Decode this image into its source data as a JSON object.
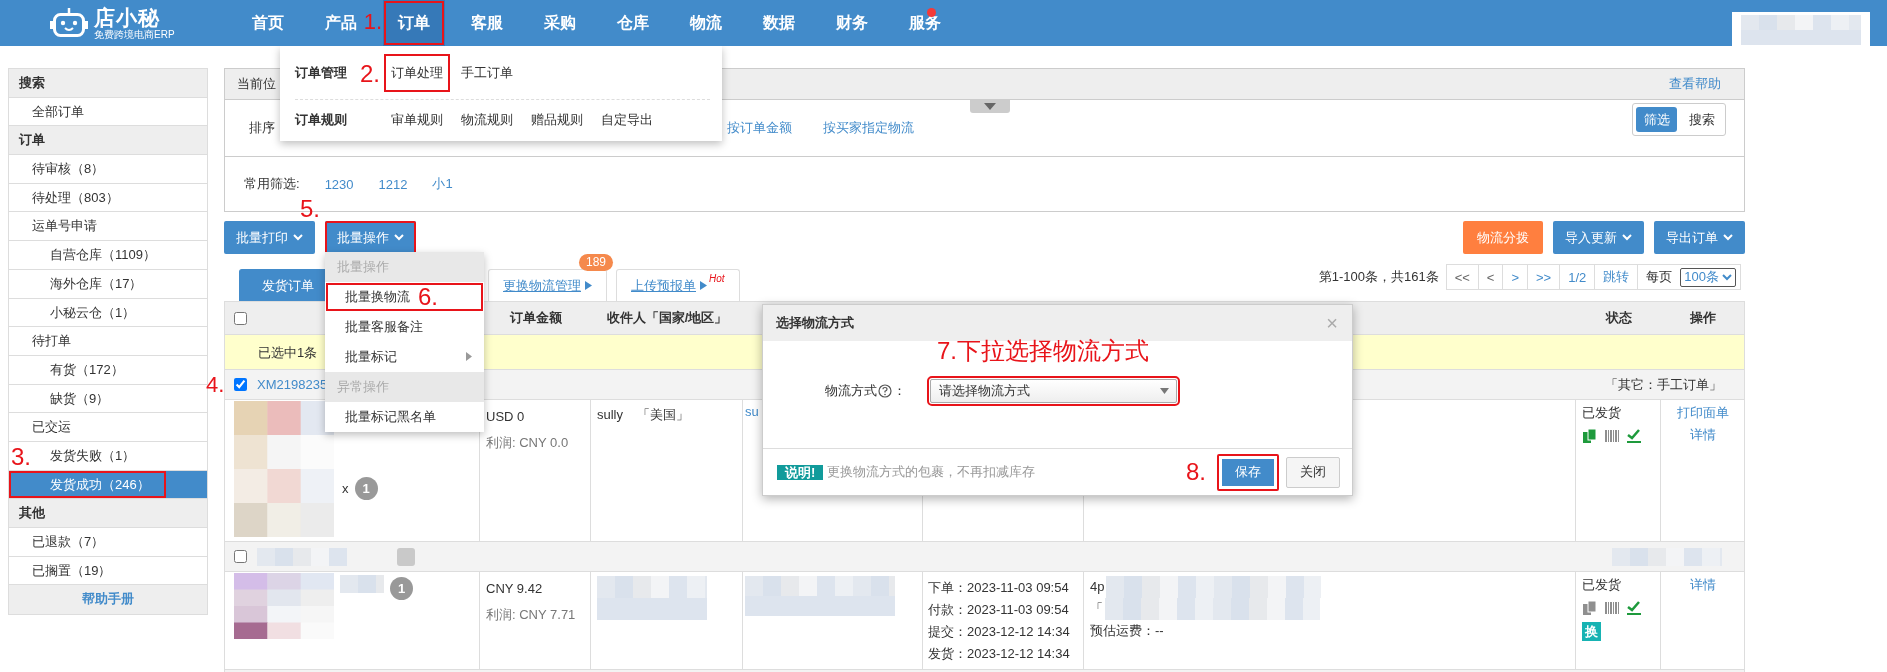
{
  "nav": {
    "logo": {
      "title": "店小秘",
      "subtitle": "免费跨境电商ERP"
    },
    "items": [
      {
        "label": "首页",
        "selected": false,
        "outlined": false,
        "dot": false
      },
      {
        "label": "产品",
        "selected": false,
        "outlined": false,
        "dot": false
      },
      {
        "label": "订单",
        "selected": true,
        "outlined": true,
        "dot": false,
        "annotation": "1."
      },
      {
        "label": "客服",
        "selected": false,
        "outlined": false,
        "dot": false
      },
      {
        "label": "采购",
        "selected": false,
        "outlined": false,
        "dot": false
      },
      {
        "label": "仓库",
        "selected": false,
        "outlined": false,
        "dot": false
      },
      {
        "label": "物流",
        "selected": false,
        "outlined": false,
        "dot": false
      },
      {
        "label": "数据",
        "selected": false,
        "outlined": false,
        "dot": false
      },
      {
        "label": "财务",
        "selected": false,
        "outlined": false,
        "dot": false
      },
      {
        "label": "服务",
        "selected": false,
        "outlined": false,
        "dot": true
      }
    ],
    "user_box": {
      "kind": "redacted"
    }
  },
  "nav_menu": {
    "groups": [
      {
        "title": "订单管理",
        "links": [
          {
            "label": "订单处理",
            "outlined": true,
            "annotation": "2."
          },
          {
            "label": "手工订单",
            "outlined": false
          }
        ]
      },
      {
        "title": "订单规则",
        "links": [
          {
            "label": "审单规则",
            "outlined": false
          },
          {
            "label": "物流规则",
            "outlined": false
          },
          {
            "label": "赠品规则",
            "outlined": false
          },
          {
            "label": "自定导出",
            "outlined": false
          }
        ]
      }
    ]
  },
  "sidebar": {
    "sections": [
      {
        "title": "搜索",
        "items": [
          {
            "label": "全部订单",
            "selected": false
          }
        ]
      },
      {
        "title": "订单",
        "items": [
          {
            "label": "待审核（8）",
            "selected": false
          },
          {
            "label": "待处理（803）",
            "selected": false
          },
          {
            "label": "运单号申请",
            "selected": false,
            "children": [
              {
                "label": "自营仓库（1109）",
                "selected": false
              },
              {
                "label": "海外仓库（17）",
                "selected": false
              },
              {
                "label": "小秘云仓（1）",
                "selected": false
              }
            ]
          },
          {
            "label": "待打单",
            "selected": false,
            "children": [
              {
                "label": "有货（172）",
                "selected": false
              },
              {
                "label": "缺货（9）",
                "selected": false
              }
            ]
          },
          {
            "label": "已交运",
            "selected": false,
            "children": [
              {
                "label": "发货失败（1）",
                "selected": false
              },
              {
                "label": "发货成功（246）",
                "selected": true,
                "outlined": true,
                "annotation": "3."
              }
            ]
          }
        ]
      },
      {
        "title": "其他",
        "items": [
          {
            "label": "已退款（7）",
            "selected": false
          },
          {
            "label": "已搁置（19）",
            "selected": false
          }
        ]
      }
    ],
    "footer": "帮助手册"
  },
  "breadcrumb": {
    "label": "当前位",
    "help": "查看帮助"
  },
  "sort": {
    "label": "排序",
    "options": [
      "按订单金额",
      "按买家指定物流"
    ]
  },
  "view_toggle": [
    {
      "label": "筛选",
      "selected": true
    },
    {
      "label": "搜索",
      "selected": false
    }
  ],
  "common_filters": {
    "label": "常用筛选:",
    "items": [
      "1230",
      "1212",
      "小1"
    ]
  },
  "toolbar": {
    "left": [
      {
        "label": "批量打印",
        "kind": "primary",
        "dropdown": true,
        "outlined": false
      },
      {
        "label": "批量操作",
        "kind": "primary",
        "dropdown": true,
        "outlined": true,
        "annotation": "5."
      }
    ],
    "right": [
      {
        "label": "物流分拨",
        "kind": "warning",
        "dropdown": false,
        "outlined": false
      },
      {
        "label": "导入更新",
        "kind": "primary",
        "dropdown": true,
        "outlined": false
      },
      {
        "label": "导出订单",
        "kind": "primary",
        "dropdown": true,
        "outlined": false
      }
    ]
  },
  "bulk_menu": {
    "items": [
      {
        "kind": "header",
        "label": "批量操作"
      },
      {
        "kind": "item",
        "label": "批量换物流",
        "outlined": true,
        "submenu": false,
        "annotation": "6."
      },
      {
        "kind": "item",
        "label": "批量客服备注",
        "outlined": false,
        "submenu": false
      },
      {
        "kind": "item",
        "label": "批量标记",
        "outlined": false,
        "submenu": true
      },
      {
        "kind": "header",
        "label": "异常操作"
      },
      {
        "kind": "item",
        "label": "批量标记黑名单",
        "outlined": false,
        "submenu": false
      }
    ]
  },
  "tabs": [
    {
      "label": "发货订单",
      "selected": true,
      "arrow": false
    },
    {
      "label": "更换物流管理",
      "selected": false,
      "arrow": true,
      "badge": "189"
    },
    {
      "label": "上传预报单",
      "selected": false,
      "arrow": true,
      "hot": "Hot"
    }
  ],
  "pager": {
    "summary": "第1-100条，共161条",
    "buttons": [
      {
        "label": "<<",
        "disabled": true
      },
      {
        "label": "<",
        "disabled": true
      },
      {
        "label": ">",
        "disabled": false
      },
      {
        "label": ">>",
        "disabled": false
      },
      {
        "label": "1/2",
        "disabled": false
      },
      {
        "label": "跳转",
        "disabled": false
      }
    ],
    "per_page_label": "每页",
    "per_page": "100条"
  },
  "table": {
    "columns": [
      {
        "kind": "checkbox",
        "checked": false
      },
      {
        "kind": "text",
        "label": "订单金额"
      },
      {
        "kind": "text",
        "label": "收件人「国家/地区」"
      },
      {
        "kind": "blank"
      },
      {
        "kind": "blank"
      },
      {
        "kind": "blank"
      },
      {
        "kind": "text",
        "label": "状态"
      },
      {
        "kind": "text",
        "label": "操作"
      }
    ],
    "selection_notice": "已选中1条",
    "orders": [
      {
        "checked": true,
        "annotation": "4.",
        "order_no": {
          "kind": "link",
          "text": "XM2198235"
        },
        "source": {
          "kind": "text",
          "text": "「其它：手工订单」"
        },
        "product": {
          "kind": "picture",
          "times": "x",
          "qty": "1"
        },
        "amount": "USD 0",
        "profit": "利润: CNY 0.0",
        "recipient": {
          "kind": "text",
          "name": "sully",
          "country": "「美国」"
        },
        "buyer": {
          "kind": "link",
          "text": "su"
        },
        "status": "已发货",
        "status_icons": [
          {
            "kind": "documents",
            "active": true
          },
          {
            "kind": "barcode",
            "active": false
          },
          {
            "kind": "check",
            "active": true
          }
        ],
        "actions": [
          "打印面单",
          "详情"
        ]
      },
      {
        "checked": false,
        "order_no": {
          "kind": "redacted"
        },
        "source": {
          "kind": "redacted"
        },
        "product": {
          "kind": "picture",
          "qty": "1"
        },
        "amount": "CNY 9.42",
        "profit": "利润: CNY 7.71",
        "recipient": {
          "kind": "redacted"
        },
        "buyer": {
          "kind": "redacted"
        },
        "dates": [
          "下单：2023-11-03 09:54",
          "付款：2023-11-03 09:54",
          "提交：2023-12-12 14:34",
          "发货：2023-12-12 14:34"
        ],
        "logistics": [
          {
            "text": "4p",
            "redacted": true
          },
          {
            "text": "「",
            "redacted": true
          },
          {
            "text": "预估运费：--",
            "redacted": false
          }
        ],
        "status": "已发货",
        "status_icons": [
          {
            "kind": "documents",
            "active": false
          },
          {
            "kind": "barcode",
            "active": false
          },
          {
            "kind": "check",
            "active": true
          }
        ],
        "tag": "换",
        "actions": [
          "详情"
        ]
      }
    ]
  },
  "modal": {
    "title": "选择物流方式",
    "close": "×",
    "annotation": "7.下拉选择物流方式",
    "field": {
      "label": "物流方式",
      "help": true,
      "colon": "：",
      "placeholder": "请选择物流方式",
      "outlined": true
    },
    "note_tag": "说明!",
    "note": "更换物流方式的包裹，不再扣减库存",
    "buttons": [
      {
        "label": "保存",
        "kind": "primary",
        "outlined": true,
        "annotation": "8."
      },
      {
        "label": "关闭",
        "kind": "default",
        "outlined": false
      }
    ]
  }
}
